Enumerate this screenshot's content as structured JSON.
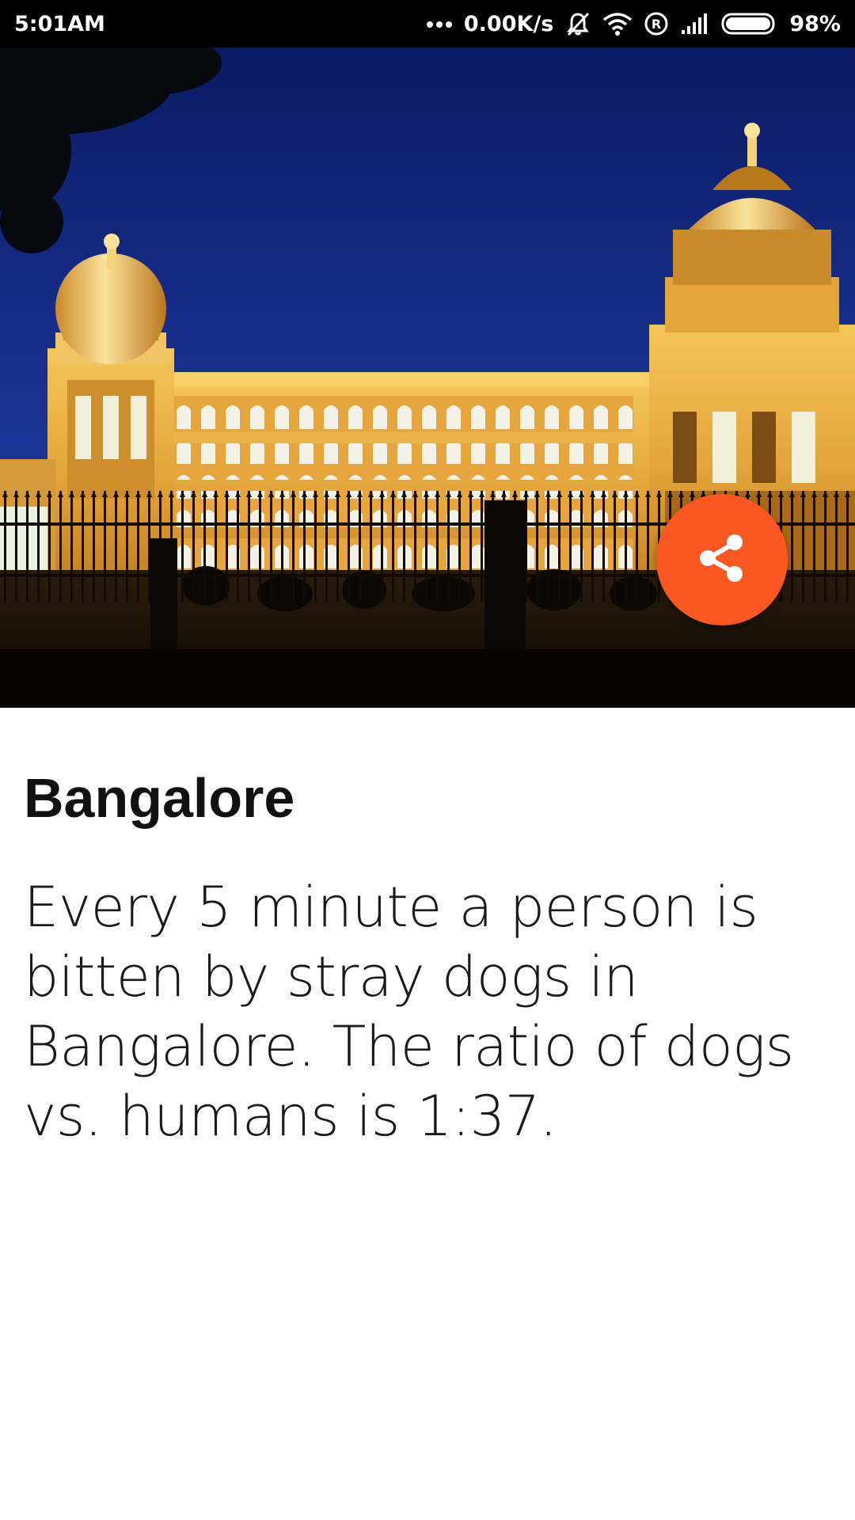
{
  "status_bar": {
    "time": "5:01AM",
    "network_speed": "0.00K/s",
    "battery_percent": "98%",
    "icons": [
      "more-dots-icon",
      "silent-bell-icon",
      "wifi-icon",
      "roaming-r-icon",
      "signal-icon",
      "battery-icon"
    ]
  },
  "hero": {
    "image_subject": "vidhana-soudha-night-photo"
  },
  "fab": {
    "icon": "share-icon",
    "color": "#fb5722"
  },
  "article": {
    "title": "Bangalore",
    "body": "Every 5 minute a person is bitten by stray dogs in Bangalore. The ratio of dogs vs. humans is 1:37."
  }
}
